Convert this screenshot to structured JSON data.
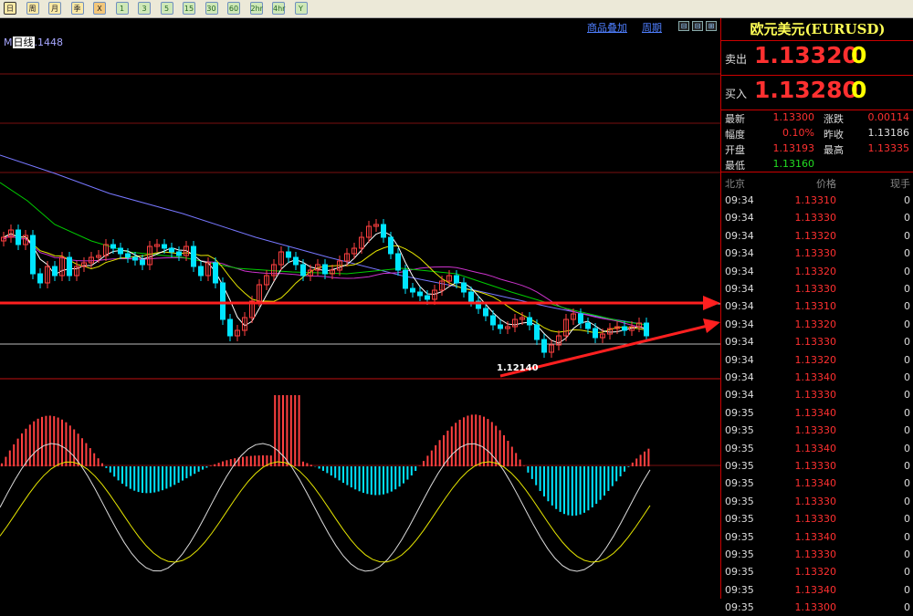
{
  "toolbar": {
    "buttons": [
      {
        "label": "日",
        "selected": true,
        "kind": "cn"
      },
      {
        "label": "周",
        "kind": "cn"
      },
      {
        "label": "月",
        "kind": "cn"
      },
      {
        "label": "季",
        "kind": "cn"
      },
      {
        "label": "X",
        "kind": "kb"
      },
      {
        "label": "1",
        "kind": "num"
      },
      {
        "label": "3",
        "kind": "num"
      },
      {
        "label": "5",
        "kind": "num"
      },
      {
        "label": "15",
        "kind": "num"
      },
      {
        "label": "30",
        "kind": "num"
      },
      {
        "label": "60",
        "kind": "num"
      },
      {
        "label": "2hr",
        "kind": "num"
      },
      {
        "label": "4hr",
        "kind": "num"
      },
      {
        "label": "Y",
        "kind": "num"
      }
    ]
  },
  "chart": {
    "link_overlay": "商品叠加",
    "link_period": "周期",
    "ma_prefix": "M",
    "ma_day": "日线",
    "ma_value": ".1448",
    "low_label": "1.12140",
    "colors": {
      "up": "#ff4040",
      "down": "#00e5ff",
      "ma_short": "#ffffff",
      "ma_mid": "#e6e600",
      "ma_long": "#00cc00",
      "ma_longer": "#cc33cc",
      "ma_longest": "#7777ff",
      "arrow": "#ff2020"
    }
  },
  "panel": {
    "title": "欧元美元(EURUSD)",
    "sell_label": "卖出",
    "sell_price": "1.13320",
    "sell_vol": "0",
    "buy_label": "买入",
    "buy_price": "1.13280",
    "buy_vol": "0",
    "stats": {
      "latest_label": "最新",
      "latest": "1.13300",
      "change_label": "涨跌",
      "change": "0.00114",
      "range_label": "幅度",
      "range": "0.10%",
      "prev_label": "昨收",
      "prev": "1.13186",
      "open_label": "开盘",
      "open": "1.13193",
      "high_label": "最高",
      "high": "1.13335",
      "low_label": "最低",
      "low": "1.13160"
    },
    "ticks_header": {
      "time": "北京",
      "price": "价格",
      "qty": "现手"
    },
    "ticks": [
      {
        "time": "09:34",
        "price": "1.13310",
        "qty": "0"
      },
      {
        "time": "09:34",
        "price": "1.13330",
        "qty": "0"
      },
      {
        "time": "09:34",
        "price": "1.13320",
        "qty": "0"
      },
      {
        "time": "09:34",
        "price": "1.13330",
        "qty": "0"
      },
      {
        "time": "09:34",
        "price": "1.13320",
        "qty": "0"
      },
      {
        "time": "09:34",
        "price": "1.13330",
        "qty": "0"
      },
      {
        "time": "09:34",
        "price": "1.13310",
        "qty": "0"
      },
      {
        "time": "09:34",
        "price": "1.13320",
        "qty": "0"
      },
      {
        "time": "09:34",
        "price": "1.13330",
        "qty": "0"
      },
      {
        "time": "09:34",
        "price": "1.13320",
        "qty": "0"
      },
      {
        "time": "09:34",
        "price": "1.13340",
        "qty": "0"
      },
      {
        "time": "09:34",
        "price": "1.13330",
        "qty": "0"
      },
      {
        "time": "09:35",
        "price": "1.13340",
        "qty": "0"
      },
      {
        "time": "09:35",
        "price": "1.13330",
        "qty": "0"
      },
      {
        "time": "09:35",
        "price": "1.13340",
        "qty": "0"
      },
      {
        "time": "09:35",
        "price": "1.13330",
        "qty": "0"
      },
      {
        "time": "09:35",
        "price": "1.13340",
        "qty": "0"
      },
      {
        "time": "09:35",
        "price": "1.13330",
        "qty": "0"
      },
      {
        "time": "09:35",
        "price": "1.13330",
        "qty": "0"
      },
      {
        "time": "09:35",
        "price": "1.13340",
        "qty": "0"
      },
      {
        "time": "09:35",
        "price": "1.13330",
        "qty": "0"
      },
      {
        "time": "09:35",
        "price": "1.13320",
        "qty": "0"
      },
      {
        "time": "09:35",
        "price": "1.13340",
        "qty": "0"
      },
      {
        "time": "09:35",
        "price": "1.13300",
        "qty": "0"
      }
    ]
  }
}
